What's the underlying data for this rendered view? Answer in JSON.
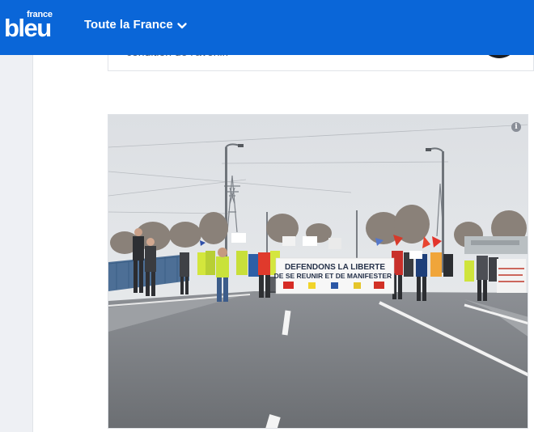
{
  "header": {
    "logo_small": "france",
    "logo_big": "bleu",
    "region_label": "Toute la France",
    "icons": {
      "dropdown": "chevron-down-icon"
    },
    "colors": {
      "background": "#0a66d8",
      "text": "#ffffff"
    }
  },
  "previous_card": {
    "text": "condition de l'avenir.",
    "icons": {
      "avatar": "dark-circle-image"
    }
  },
  "article_image": {
    "banner_line1": "DEFENDONS LA LIBERTE",
    "banner_line2": "DE SE REUNIR ET DE MANIFESTER !",
    "icons": {
      "info": "info-icon"
    }
  }
}
